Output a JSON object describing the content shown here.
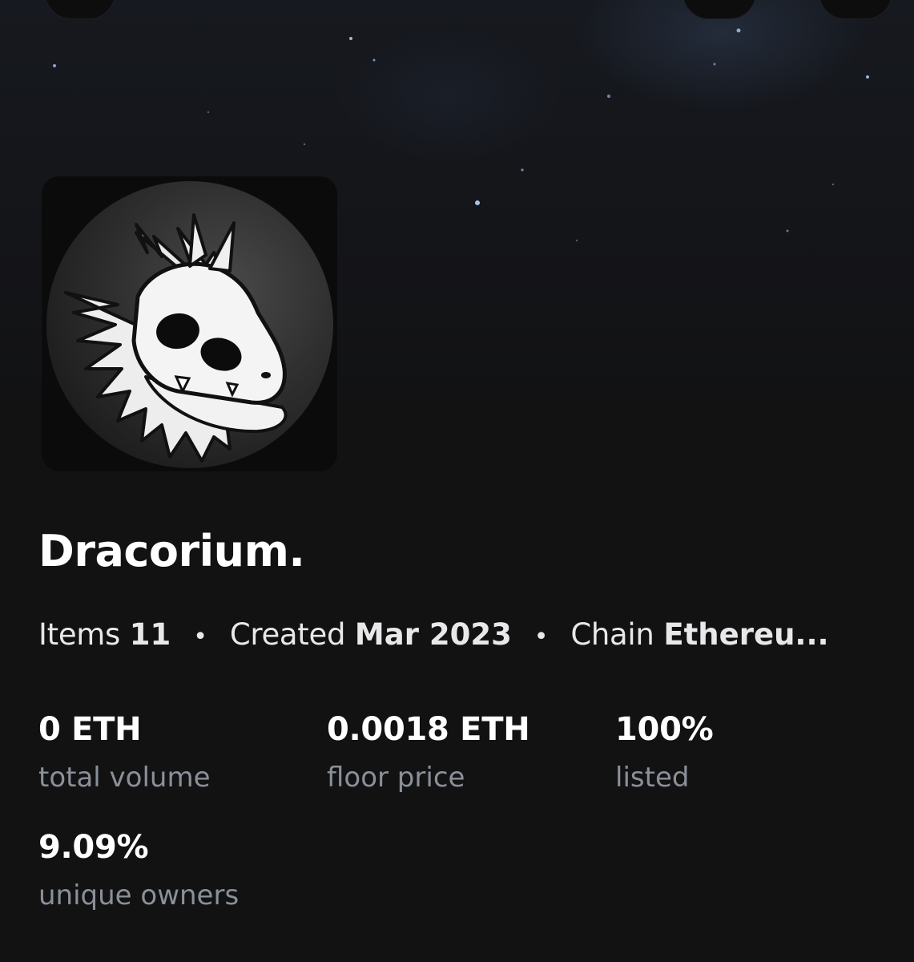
{
  "collection": {
    "name": "Dracorium.",
    "meta": {
      "items_label": "Items",
      "items_value": "11",
      "created_label": "Created",
      "created_value": "Mar 2023",
      "chain_label": "Chain",
      "chain_value": "Ethereu...",
      "separator": "•"
    }
  },
  "stats": [
    {
      "value": "0 ETH",
      "label": "total volume"
    },
    {
      "value": "0.0018 ETH",
      "label": "floor price"
    },
    {
      "value": "100%",
      "label": "listed"
    },
    {
      "value": "9.09%",
      "label": "unique owners"
    }
  ],
  "colors": {
    "background": "#121213",
    "label_gray": "#8a9099",
    "text": "#ffffff"
  },
  "icons": {
    "avatar": "dragon-skull-logo"
  }
}
